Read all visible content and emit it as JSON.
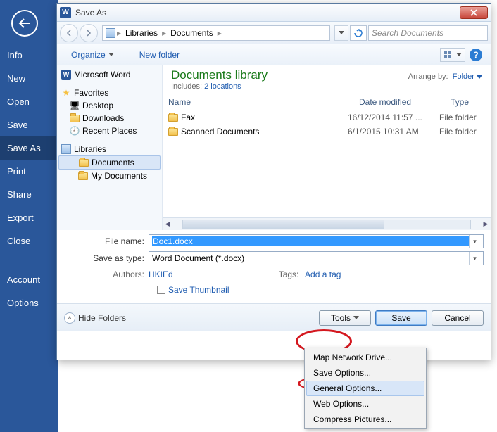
{
  "word_menu": {
    "items": [
      "Info",
      "New",
      "Open",
      "Save",
      "Save As",
      "Print",
      "Share",
      "Export",
      "Close",
      "Account",
      "Options"
    ],
    "selected": "Save As"
  },
  "dialog": {
    "title": "Save As",
    "breadcrumbs": [
      "Libraries",
      "Documents"
    ],
    "search_placeholder": "Search Documents",
    "toolbar": {
      "organize": "Organize",
      "new_folder": "New folder"
    },
    "sidebar": {
      "ms_word": "Microsoft Word",
      "favorites": "Favorites",
      "fav_items": [
        "Desktop",
        "Downloads",
        "Recent Places"
      ],
      "libraries": "Libraries",
      "lib_items": [
        "Documents",
        "My Documents"
      ]
    },
    "main": {
      "title": "Documents library",
      "subtitle_prefix": "Includes: ",
      "subtitle_link": "2 locations",
      "arrange_label": "Arrange by:",
      "arrange_value": "Folder",
      "columns": [
        "Name",
        "Date modified",
        "Type"
      ],
      "files": [
        {
          "name": "Fax",
          "date": "16/12/2014 11:57 ...",
          "type": "File folder"
        },
        {
          "name": "Scanned Documents",
          "date": "6/1/2015 10:31 AM",
          "type": "File folder"
        }
      ]
    },
    "form": {
      "file_name_label": "File name:",
      "file_name_value": "Doc1.docx",
      "save_type_label": "Save as type:",
      "save_type_value": "Word Document (*.docx)",
      "authors_label": "Authors:",
      "authors_value": "HKIEd",
      "tags_label": "Tags:",
      "tags_value": "Add a tag",
      "save_thumb": "Save Thumbnail"
    },
    "footer": {
      "hide_folders": "Hide Folders",
      "tools": "Tools",
      "save": "Save",
      "cancel": "Cancel"
    },
    "tools_menu": [
      "Map Network Drive...",
      "Save Options...",
      "General Options...",
      "Web Options...",
      "Compress Pictures..."
    ]
  }
}
